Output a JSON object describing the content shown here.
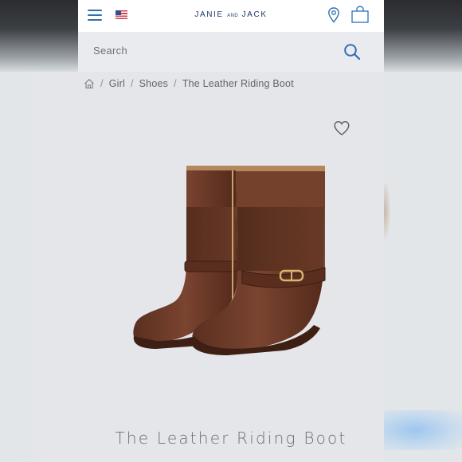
{
  "header": {
    "brand_main": "JANIE",
    "brand_and": "AND",
    "brand_end": "JACK",
    "menu_icon": "hamburger-menu-icon",
    "flag_icon": "us-flag-icon",
    "location_icon": "map-pin-icon",
    "bag_icon": "shopping-bag-icon",
    "accent_color": "#2f6fb5"
  },
  "search": {
    "placeholder": "Search",
    "icon": "search-icon"
  },
  "breadcrumb": {
    "home_icon": "home-icon",
    "separator": "/",
    "items": [
      "Girl",
      "Shoes",
      "The Leather Riding Boot"
    ]
  },
  "product": {
    "name": "The Leather Riding Boot",
    "wishlist_icon": "heart-icon",
    "image_alt": "brown leather riding boots",
    "boot_color": "#6a3a27"
  }
}
